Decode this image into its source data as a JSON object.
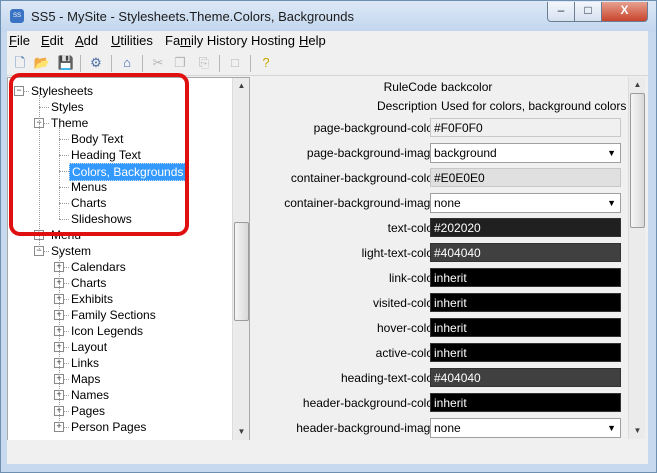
{
  "window": {
    "title": "SS5 - MySite - Stylesheets.Theme.Colors, Backgrounds",
    "app_icon": "SS",
    "minimize_glyph": "–",
    "maximize_glyph": "□",
    "close_glyph": "X"
  },
  "menu": {
    "items": [
      {
        "key": "F",
        "rest": "ile"
      },
      {
        "key": "E",
        "rest": "dit"
      },
      {
        "key": "A",
        "rest": "dd"
      },
      {
        "key": "U",
        "rest": "tilities"
      },
      {
        "pre": "Fa",
        "key": "m",
        "rest": "ily History Hosting"
      },
      {
        "key": "H",
        "rest": "elp"
      }
    ]
  },
  "toolbar": {
    "icons": [
      {
        "name": "new-file-icon",
        "glyph": "🗋"
      },
      {
        "name": "open-folder-icon",
        "glyph": "📂"
      },
      {
        "name": "save-icon",
        "glyph": "💾"
      },
      {
        "name": "settings-gear-icon",
        "glyph": "⚙"
      },
      {
        "name": "home-icon",
        "glyph": "⌂"
      },
      {
        "name": "cut-icon",
        "glyph": "✂"
      },
      {
        "name": "copy-icon",
        "glyph": "❐"
      },
      {
        "name": "paste-icon",
        "glyph": "⎘"
      },
      {
        "name": "blank-page-icon",
        "glyph": "□"
      },
      {
        "name": "help-icon",
        "glyph": "?"
      }
    ]
  },
  "tree": {
    "expanded_glyph": "−",
    "collapsed_glyph": "+",
    "items": [
      {
        "label": "Stylesheets",
        "level": 0,
        "expander": "minus"
      },
      {
        "label": "Styles",
        "level": 1,
        "expander": "none"
      },
      {
        "label": "Theme",
        "level": 1,
        "expander": "minus"
      },
      {
        "label": "Body Text",
        "level": 2,
        "expander": "none"
      },
      {
        "label": "Heading Text",
        "level": 2,
        "expander": "none"
      },
      {
        "label": "Colors, Backgrounds",
        "level": 2,
        "expander": "none",
        "selected": true
      },
      {
        "label": "Menus",
        "level": 2,
        "expander": "none"
      },
      {
        "label": "Charts",
        "level": 2,
        "expander": "none"
      },
      {
        "label": "Slideshows",
        "level": 2,
        "expander": "none"
      },
      {
        "label": "Menu",
        "level": 1,
        "expander": "plus"
      },
      {
        "label": "System",
        "level": 1,
        "expander": "minus"
      },
      {
        "label": "Calendars",
        "level": 2,
        "expander": "plus"
      },
      {
        "label": "Charts",
        "level": 2,
        "expander": "plus"
      },
      {
        "label": "Exhibits",
        "level": 2,
        "expander": "plus"
      },
      {
        "label": "Family Sections",
        "level": 2,
        "expander": "plus"
      },
      {
        "label": "Icon Legends",
        "level": 2,
        "expander": "plus"
      },
      {
        "label": "Layout",
        "level": 2,
        "expander": "plus"
      },
      {
        "label": "Links",
        "level": 2,
        "expander": "plus"
      },
      {
        "label": "Maps",
        "level": 2,
        "expander": "plus"
      },
      {
        "label": "Names",
        "level": 2,
        "expander": "plus"
      },
      {
        "label": "Pages",
        "level": 2,
        "expander": "plus"
      },
      {
        "label": "Person Pages",
        "level": 2,
        "expander": "plus"
      }
    ],
    "scroll": {
      "up_glyph": "▲",
      "down_glyph": "▼",
      "position": 0.55
    }
  },
  "properties": {
    "rule_code": {
      "label": "RuleCode",
      "value": "backcolor"
    },
    "description": {
      "label": "Description",
      "value": "Used for colors, background colors and"
    },
    "fields": [
      {
        "label": "page-background-color",
        "kind": "text",
        "value": "#F0F0F0",
        "bg": "#F0F0F0",
        "fg": "#000000"
      },
      {
        "label": "page-background-image",
        "kind": "select",
        "value": "background"
      },
      {
        "label": "container-background-color",
        "kind": "text",
        "value": "#E0E0E0",
        "bg": "#E0E0E0",
        "fg": "#000000"
      },
      {
        "label": "container-background-image",
        "kind": "select",
        "value": "none"
      },
      {
        "label": "text-color",
        "kind": "text",
        "value": "#202020",
        "bg": "#202020",
        "fg": "#FFFFFF"
      },
      {
        "label": "light-text-color",
        "kind": "text",
        "value": "#404040",
        "bg": "#404040",
        "fg": "#FFFFFF"
      },
      {
        "label": "link-color",
        "kind": "text",
        "value": "inherit",
        "bg": "#000000",
        "fg": "#FFFFFF"
      },
      {
        "label": "visited-color",
        "kind": "text",
        "value": "inherit",
        "bg": "#000000",
        "fg": "#FFFFFF"
      },
      {
        "label": "hover-color",
        "kind": "text",
        "value": "inherit",
        "bg": "#000000",
        "fg": "#FFFFFF"
      },
      {
        "label": "active-color",
        "kind": "text",
        "value": "inherit",
        "bg": "#000000",
        "fg": "#FFFFFF"
      },
      {
        "label": "heading-text-color",
        "kind": "text",
        "value": "#404040",
        "bg": "#404040",
        "fg": "#FFFFFF"
      },
      {
        "label": "header-background-color",
        "kind": "text",
        "value": "inherit",
        "bg": "#000000",
        "fg": "#FFFFFF"
      },
      {
        "label": "header-background-image",
        "kind": "select",
        "value": "none"
      }
    ],
    "scroll": {
      "up_glyph": "▲",
      "down_glyph": "▼",
      "position": 0.0
    },
    "select_arrow": "▼"
  }
}
